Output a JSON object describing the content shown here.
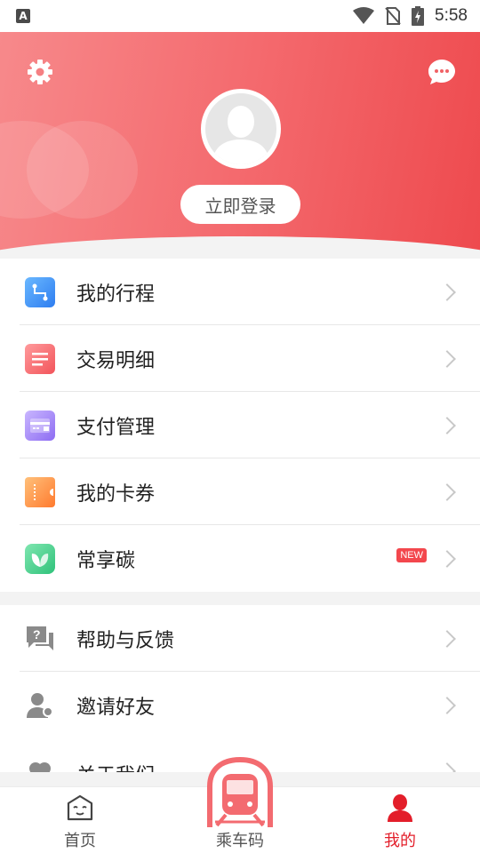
{
  "status_bar": {
    "time": "5:58",
    "notification_badge": "A"
  },
  "header": {
    "login_label": "立即登录"
  },
  "menu_group_1": [
    {
      "label": "我的行程",
      "icon": "route-icon"
    },
    {
      "label": "交易明细",
      "icon": "list-icon"
    },
    {
      "label": "支付管理",
      "icon": "card-icon"
    },
    {
      "label": "我的卡券",
      "icon": "coupon-icon"
    },
    {
      "label": "常享碳",
      "icon": "leaf-icon",
      "badge": "NEW"
    }
  ],
  "menu_group_2": [
    {
      "label": "帮助与反馈",
      "icon": "help-feedback-icon"
    },
    {
      "label": "邀请好友",
      "icon": "invite-friend-icon"
    },
    {
      "label": "关于我们",
      "icon": "about-icon"
    }
  ],
  "bottom_nav": {
    "home": "首页",
    "ride_code": "乘车码",
    "mine": "我的"
  },
  "colors": {
    "accent": "#e31e2a",
    "header_start": "#f7898b",
    "header_end": "#ee4a4e"
  }
}
